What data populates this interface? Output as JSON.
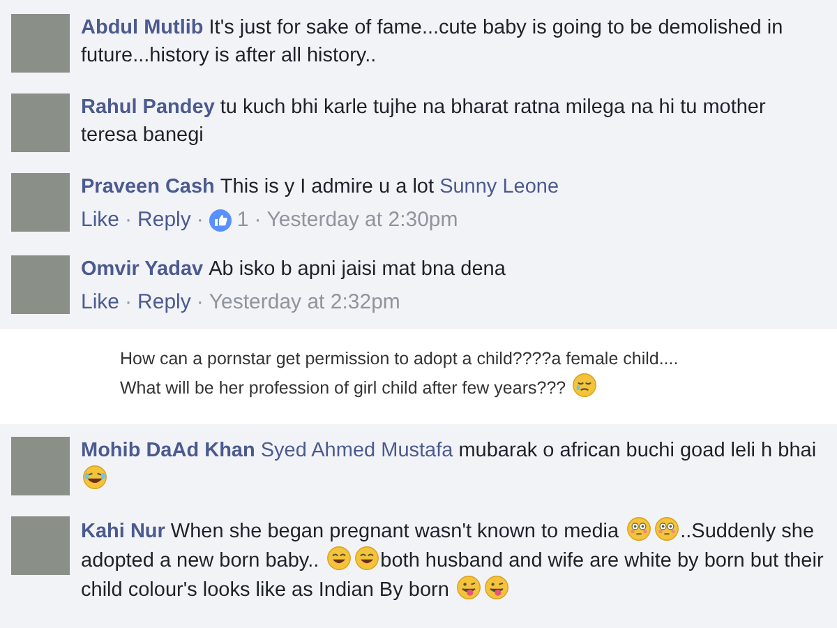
{
  "comments": [
    {
      "kind": "comment",
      "author": "Abdul Mutlib",
      "body": [
        {
          "kind": "text",
          "text": "It's just for sake of fame...cute baby is going to be demolished in future...history is after all history.."
        }
      ]
    },
    {
      "kind": "comment",
      "author": "Rahul Pandey",
      "body": [
        {
          "kind": "text",
          "text": "tu kuch bhi karle tujhe na bharat ratna milega na hi tu mother teresa banegi"
        }
      ]
    },
    {
      "kind": "comment",
      "author": "Praveen Cash",
      "body": [
        {
          "kind": "text",
          "text": "This is y I admire u a lot"
        },
        {
          "kind": "mention",
          "text": "Sunny Leone"
        }
      ],
      "actions": {
        "like": "Like",
        "sep": "·",
        "reply": "Reply",
        "likes": "1",
        "time": "Yesterday at 2:30pm"
      }
    },
    {
      "kind": "comment",
      "author": "Omvir Yadav",
      "body": [
        {
          "kind": "text",
          "text": "Ab isko b apni jaisi mat bna dena"
        }
      ],
      "actions": {
        "like": "Like",
        "sep": "·",
        "reply": "Reply",
        "time": "Yesterday at 2:32pm"
      }
    },
    {
      "kind": "snippet",
      "body": [
        {
          "kind": "text",
          "text": "How can a pornstar get permission to adopt a child????a female child...."
        },
        {
          "kind": "break"
        },
        {
          "kind": "text",
          "text": "What will be her profession of girl child after few years???"
        },
        {
          "kind": "tear"
        }
      ]
    },
    {
      "kind": "comment",
      "author": "Mohib DaAd Khan",
      "body": [
        {
          "kind": "mention",
          "text": "Syed Ahmed Mustafa"
        },
        {
          "kind": "text",
          "text": "mubarak o african buchi goad leli h bhai"
        },
        {
          "kind": "laugh"
        }
      ]
    },
    {
      "kind": "comment",
      "author": "Kahi Nur",
      "body": [
        {
          "kind": "text",
          "text": "When she began pregnant wasn't known to media"
        },
        {
          "kind": "flushed"
        },
        {
          "kind": "flushed"
        },
        {
          "kind": "text",
          "text": "..Suddenly she adopted a new born baby.."
        },
        {
          "kind": "grin"
        },
        {
          "kind": "grin"
        },
        {
          "kind": "text",
          "text": "both husband and wife are white by born but their child colour's looks like as Indian By born"
        },
        {
          "kind": "tongue"
        },
        {
          "kind": "tongue"
        }
      ]
    }
  ]
}
